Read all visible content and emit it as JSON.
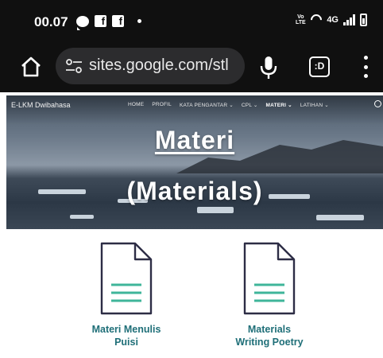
{
  "status_bar": {
    "time": "00.07",
    "network": "4G",
    "volte": "Vo LTE",
    "fb_glyph": "f"
  },
  "browser": {
    "url": "sites.google.com/stl",
    "tabs_count": ":D"
  },
  "site": {
    "title": "E-LKM Dwibahasa",
    "nav": [
      "HOME",
      "PROFIL",
      "KATA PENGANTAR ⌄",
      "CPL ⌄",
      "MATERI ⌄",
      "LATIHAN ⌄"
    ],
    "active_nav_index": 4
  },
  "hero": {
    "title": "Materi",
    "subtitle": "(Materials)"
  },
  "cards": [
    {
      "line1": "Materi Menulis",
      "line2": "Puisi"
    },
    {
      "line1": "Materials",
      "line2": "Writing Poetry"
    }
  ],
  "colors": {
    "link_teal": "#1f6f78",
    "doc_stroke": "#2d2d45",
    "doc_lines": "#3fb59a",
    "status_bg": "#101010"
  }
}
